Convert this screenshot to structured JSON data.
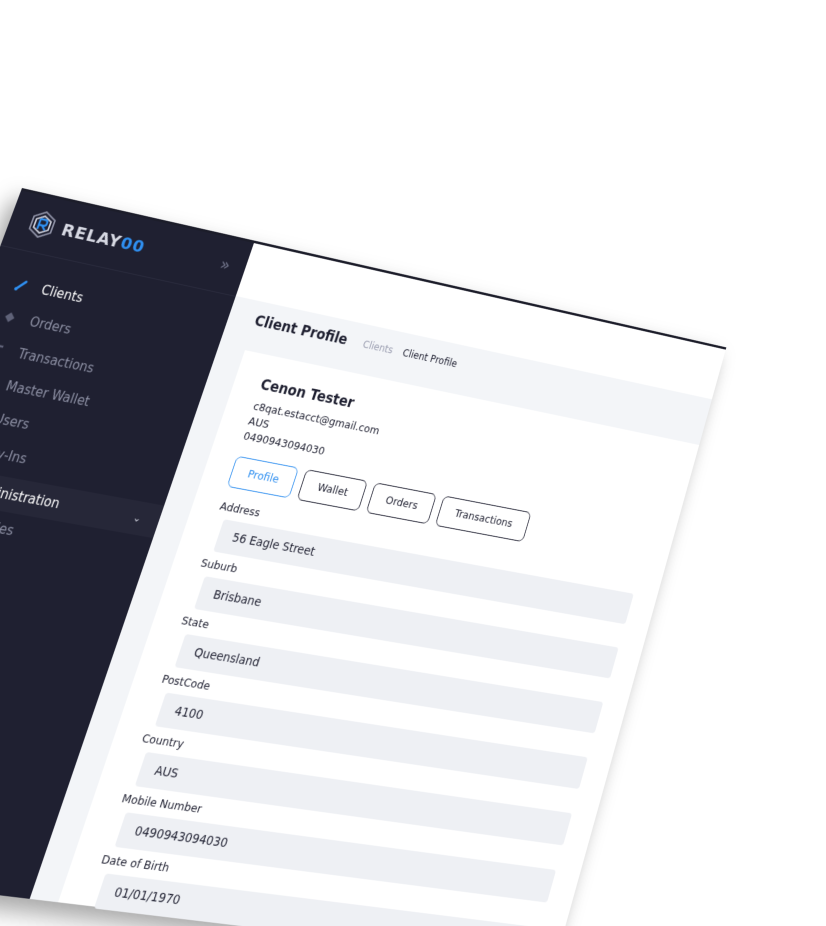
{
  "brand": {
    "name_part1": "RELAY",
    "name_part2": "00",
    "accent_color": "#2f8ff0",
    "collapse_icon": "double-chevron-right-icon"
  },
  "sidebar": {
    "items": [
      {
        "label": "Clients",
        "icon": "brush-icon",
        "active": true
      },
      {
        "label": "Orders",
        "icon": "diamond-icon"
      },
      {
        "label": "Transactions",
        "icon": "bracket-icon"
      },
      {
        "label": "Master Wallet",
        "icon": "bracket-icon"
      },
      {
        "label": "Users",
        "icon": "list-icon"
      },
      {
        "label": "Pay-Ins",
        "icon": "list-icon"
      }
    ],
    "admin": {
      "label": "Administration",
      "icon": "chat-icon",
      "expanded": true
    },
    "admin_children": [
      {
        "label": "Roles",
        "icon": "chat-icon"
      }
    ]
  },
  "header": {
    "title": "Client Profile",
    "breadcrumb": [
      "Clients",
      "Client Profile"
    ]
  },
  "client": {
    "name": "Cenon Tester",
    "email": "c8qat.estacct@gmail.com",
    "country": "AUS",
    "phone": "0490943094030"
  },
  "tabs": [
    "Profile",
    "Wallet",
    "Orders",
    "Transactions"
  ],
  "active_tab": "Profile",
  "fields": [
    {
      "label": "Address",
      "value": "56 Eagle Street"
    },
    {
      "label": "Suburb",
      "value": "Brisbane"
    },
    {
      "label": "State",
      "value": "Queensland"
    },
    {
      "label": "PostCode",
      "value": "4100"
    },
    {
      "label": "Country",
      "value": "AUS"
    },
    {
      "label": "Mobile Number",
      "value": "0490943094030"
    },
    {
      "label": "Date of Birth",
      "value": "01/01/1970"
    }
  ]
}
